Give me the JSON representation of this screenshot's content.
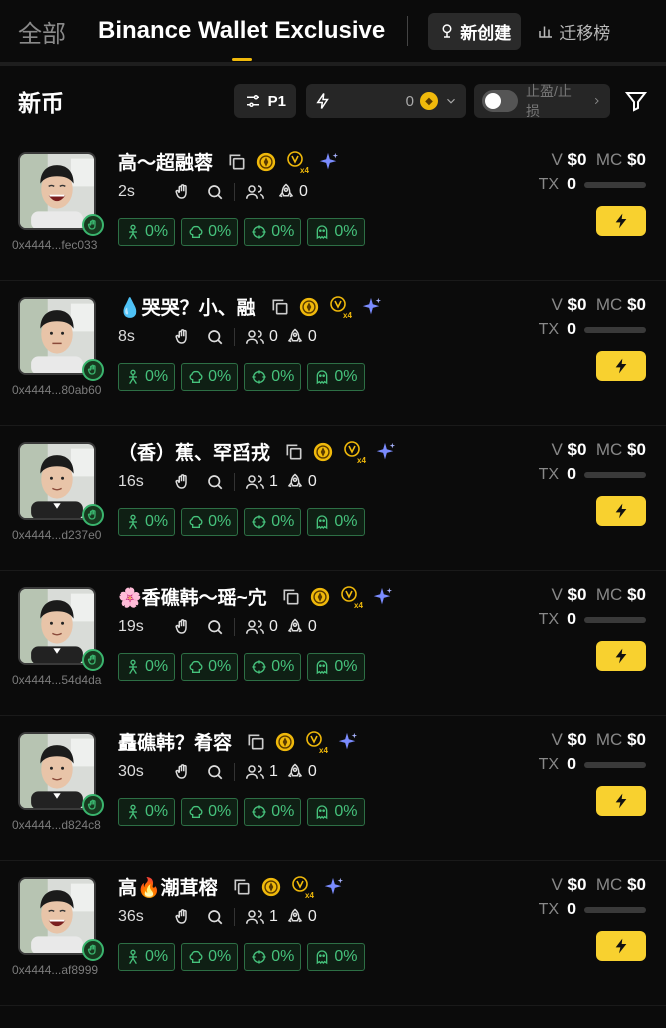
{
  "topbar": {
    "tab_all": "全部",
    "tab_binance": "Binance Wallet Exclusive",
    "btn_new": "新创建",
    "btn_migrate": "迁移榜"
  },
  "subbar": {
    "title": "新币",
    "preset": "P1",
    "amount": "0",
    "tp_sl": "止盈/止损"
  },
  "tokens": [
    {
      "name": "高～超融蓉",
      "age": "2s",
      "holders": "",
      "launches": "0",
      "address": "0x4444...fec033",
      "v": "$0",
      "mc": "$0",
      "tx": "0",
      "avatar": "laughing"
    },
    {
      "name": "💧哭哭？小、融",
      "age": "8s",
      "holders": "0",
      "launches": "0",
      "address": "0x4444...80ab60",
      "v": "$0",
      "mc": "$0",
      "tx": "0",
      "avatar": "neutral"
    },
    {
      "name": "（香）蕉、罕舀戎",
      "age": "16s",
      "holders": "1",
      "launches": "0",
      "address": "0x4444...d237e0",
      "v": "$0",
      "mc": "$0",
      "tx": "0",
      "avatar": "suit"
    },
    {
      "name": "🌸香礁韩～瑶~宂",
      "age": "19s",
      "holders": "0",
      "launches": "0",
      "address": "0x4444...54d4da",
      "v": "$0",
      "mc": "$0",
      "tx": "0",
      "avatar": "suit"
    },
    {
      "name": "矗礁韩？肴容",
      "age": "30s",
      "holders": "1",
      "launches": "0",
      "address": "0x4444...d824c8",
      "v": "$0",
      "mc": "$0",
      "tx": "0",
      "avatar": "suit"
    },
    {
      "name": "高🔥潮茸榕",
      "age": "36s",
      "holders": "1",
      "launches": "0",
      "address": "0x4444...af8999",
      "v": "$0",
      "mc": "$0",
      "tx": "0",
      "avatar": "laughing"
    }
  ],
  "pill_value": "0%",
  "labels": {
    "v": "V",
    "mc": "MC",
    "tx": "TX"
  },
  "colors": {
    "accent": "#f0b90b",
    "green": "#46c27c",
    "flash": "#f8d12f"
  }
}
